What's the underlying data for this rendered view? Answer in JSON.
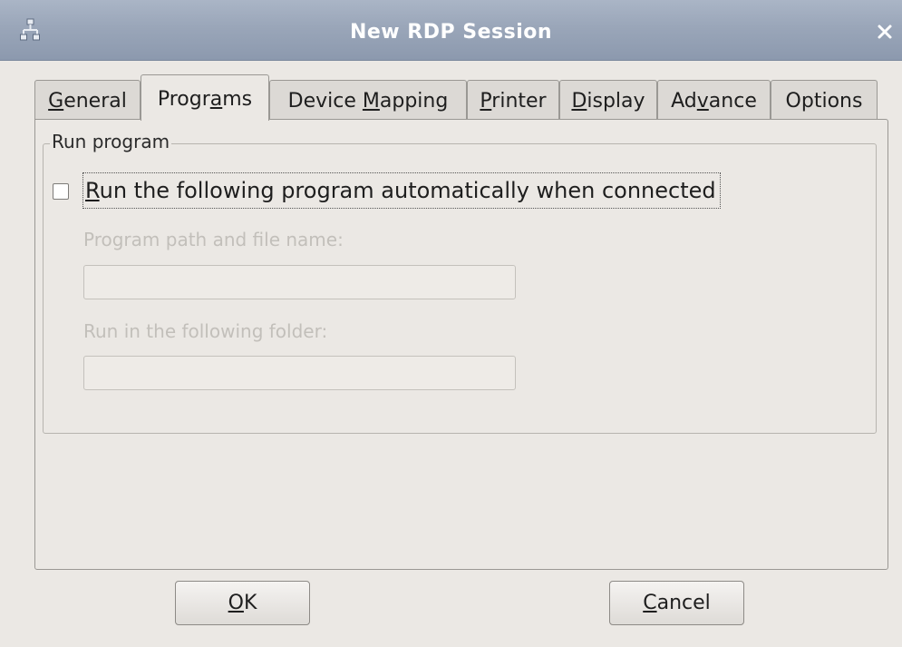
{
  "window": {
    "title": "New RDP Session",
    "icon": "network-icon",
    "close_icon": "close-icon"
  },
  "tabs": [
    {
      "pre": "",
      "mn": "G",
      "post": "eneral",
      "active": false
    },
    {
      "pre": "Progr",
      "mn": "a",
      "post": "ms",
      "active": true
    },
    {
      "pre": "Device ",
      "mn": "M",
      "post": "apping",
      "active": false
    },
    {
      "pre": "",
      "mn": "P",
      "post": "rinter",
      "active": false
    },
    {
      "pre": "",
      "mn": "D",
      "post": "isplay",
      "active": false
    },
    {
      "pre": "Ad",
      "mn": "v",
      "post": "ance",
      "active": false
    },
    {
      "pre": "Options",
      "mn": "",
      "post": "",
      "active": false
    }
  ],
  "run_program": {
    "frame_label": "Run program",
    "checkbox": {
      "mn": "R",
      "label_rest": "un the following program automatically when connected",
      "checked": false
    },
    "program_path_label": "Program path and file name:",
    "program_path_value": "",
    "folder_label": "Run in the following folder:",
    "folder_value": ""
  },
  "buttons": {
    "ok": {
      "mn": "O",
      "rest": "K"
    },
    "cancel": {
      "mn": "C",
      "rest": "ancel"
    }
  },
  "colors": {
    "titlebar": "#9aa6b9",
    "background": "#ebe8e4",
    "disabled_text": "#c2bfba"
  }
}
